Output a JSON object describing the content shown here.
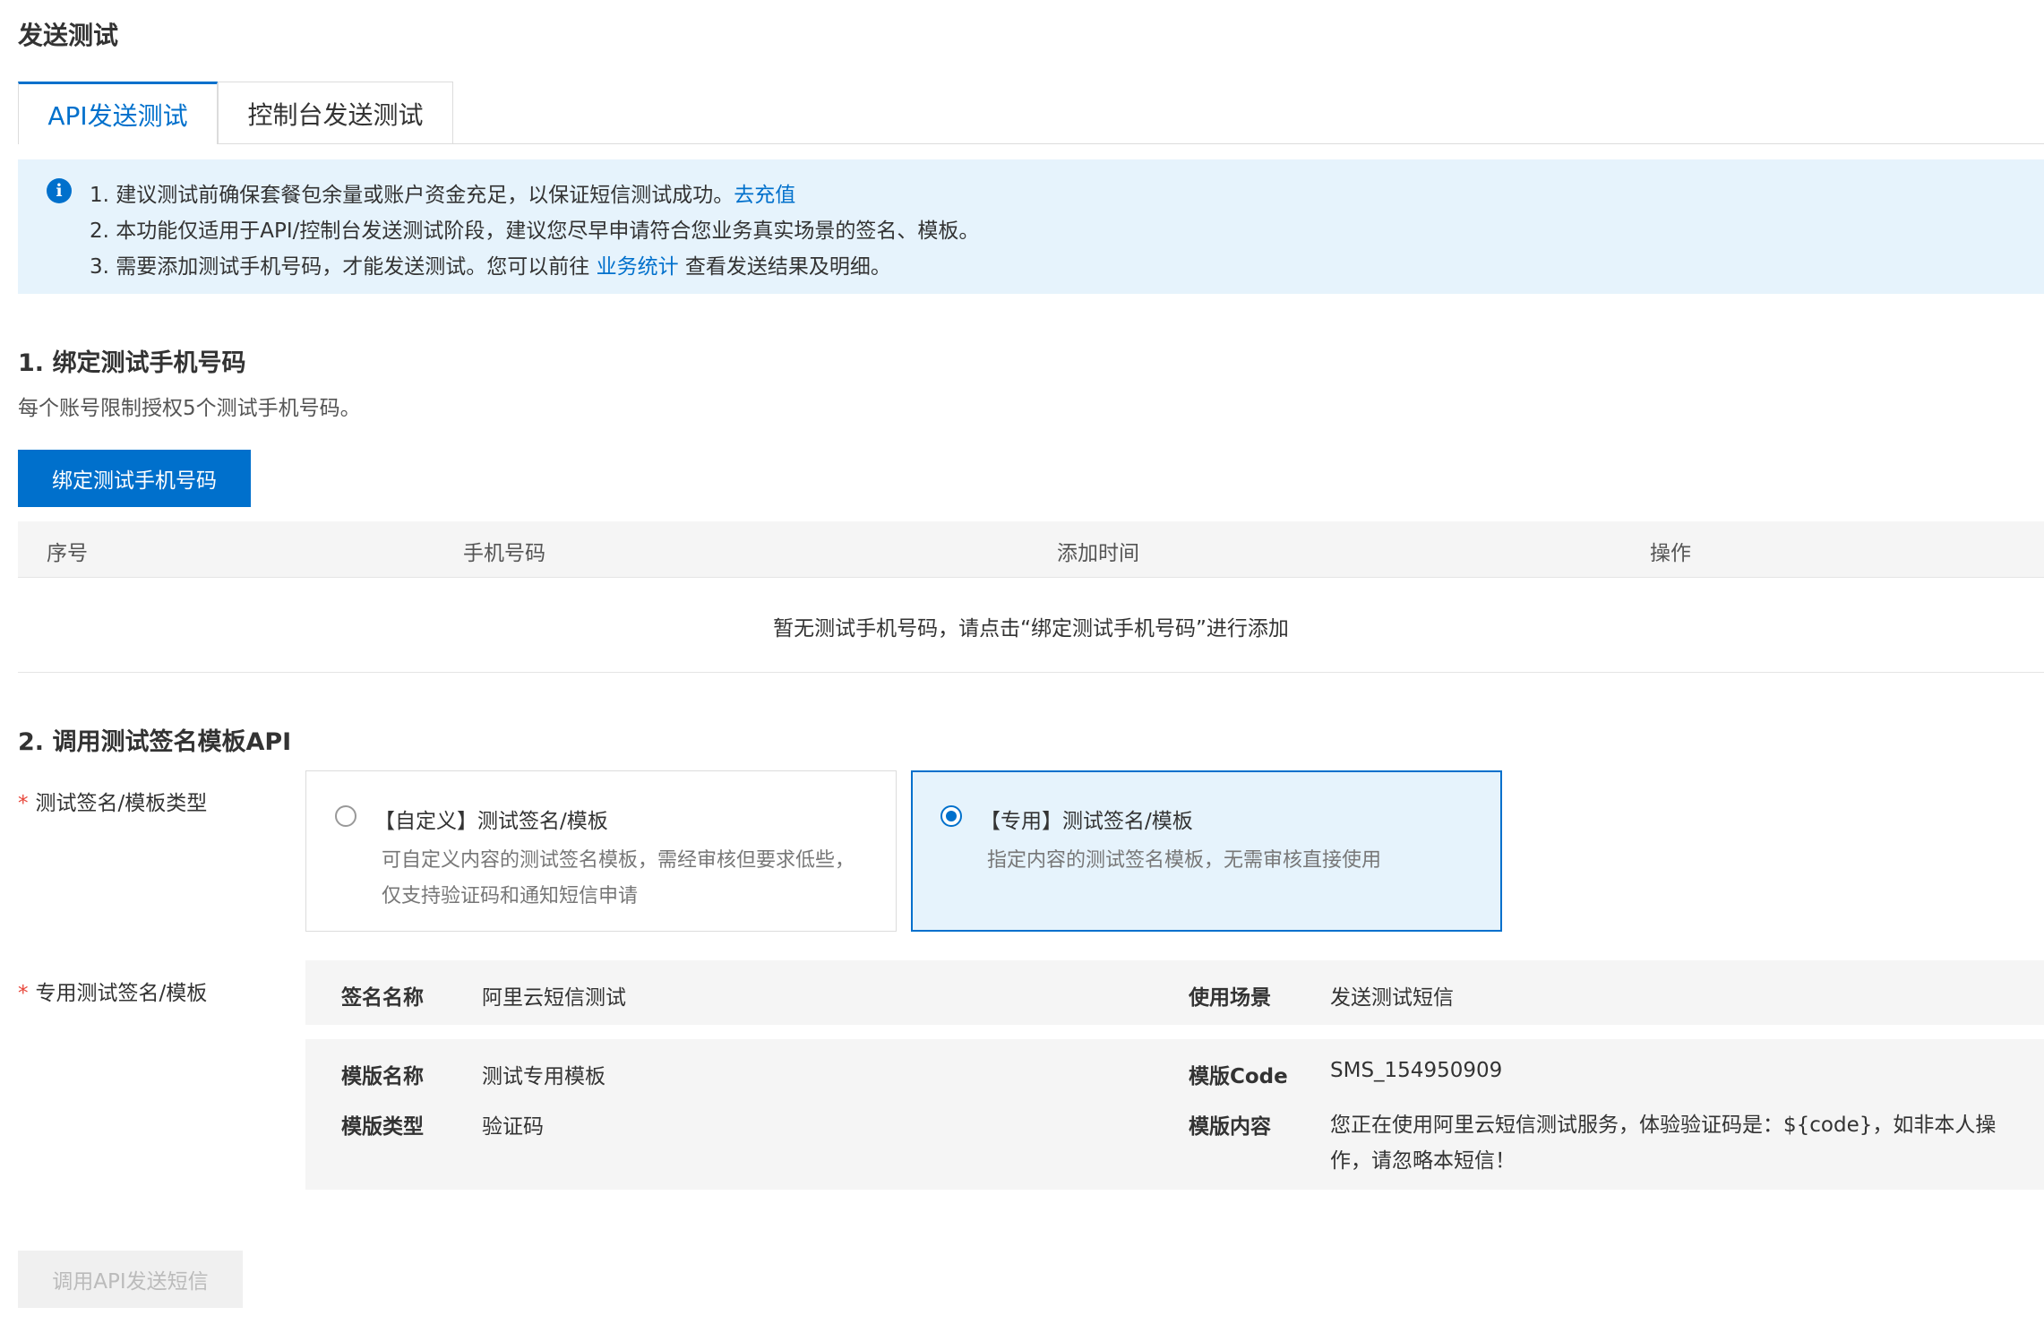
{
  "page": {
    "title": "发送测试"
  },
  "tabs": [
    {
      "label": "API发送测试",
      "active": true
    },
    {
      "label": "控制台发送测试",
      "active": false
    }
  ],
  "notice": {
    "line1": "1. 建议测试前确保套餐包余量或账户资金充足，以保证短信测试成功。",
    "line1_link": "去充值",
    "line2": "2. 本功能仅适用于API/控制台发送测试阶段，建议您尽早申请符合您业务真实场景的签名、模板。",
    "line3_pre": "3. 需要添加测试手机号码，才能发送测试。您可以前往 ",
    "line3_link": "业务统计",
    "line3_post": " 查看发送结果及明细。"
  },
  "section1": {
    "heading": "1. 绑定测试手机号码",
    "description": "每个账号限制授权5个测试手机号码。",
    "bind_button": "绑定测试手机号码",
    "table": {
      "columns": [
        "序号",
        "手机号码",
        "添加时间",
        "操作"
      ],
      "rows": [],
      "empty_text": "暂无测试手机号码，请点击“绑定测试手机号码”进行添加"
    }
  },
  "section2": {
    "heading": "2. 调用测试签名模板API",
    "type_label": "测试签名/模板类型",
    "options": [
      {
        "title": "【自定义】测试签名/模板",
        "desc": "可自定义内容的测试签名模板，需经审核但要求低些，仅支持验证码和通知短信申请",
        "selected": false
      },
      {
        "title": "【专用】测试签名/模板",
        "desc": "指定内容的测试签名模板，无需审核直接使用",
        "selected": true
      }
    ],
    "dedicated_label": "专用测试签名/模板",
    "details": {
      "sign_name_label": "签名名称",
      "sign_name": "阿里云短信测试",
      "scene_label": "使用场景",
      "scene": "发送测试短信",
      "template_name_label": "模版名称",
      "template_name": "测试专用模板",
      "template_code_label": "模版Code",
      "template_code": "SMS_154950909",
      "template_type_label": "模版类型",
      "template_type": "验证码",
      "template_content_label": "模版内容",
      "template_content": "您正在使用阿里云短信测试服务，体验验证码是：${code}，如非本人操作，请忽略本短信！"
    },
    "send_button": "调用API发送短信"
  },
  "colors": {
    "primary": "#0070cc",
    "notice_bg": "#e6f3fc",
    "required": "#e8463a",
    "panel_bg": "#f5f5f5"
  }
}
